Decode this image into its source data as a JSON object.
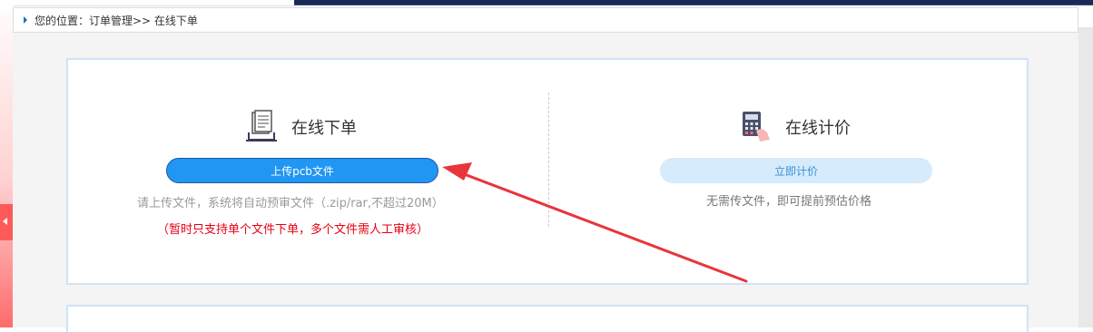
{
  "header": {
    "breadcrumb": "您的位置：订单管理>> 在线下单"
  },
  "online_order": {
    "title": "在线下单",
    "upload_button": "上传pcb文件",
    "hint": "请上传文件，系统将自动预审文件（.zip/rar,不超过20M）",
    "warning": "（暂时只支持单个文件下单，多个文件需人工审核）"
  },
  "online_quote": {
    "title": "在线计价",
    "quote_button": "立即计价",
    "hint": "无需传文件，即可提前预估价格"
  },
  "icons": {
    "order": "document-laptop-icon",
    "quote": "calculator-icon"
  },
  "colors": {
    "primary": "#2196f3",
    "primary_light": "#d6ebfb",
    "warning": "#e60012",
    "annotation_arrow": "#e8363b",
    "header_dark": "#1b2a55"
  }
}
